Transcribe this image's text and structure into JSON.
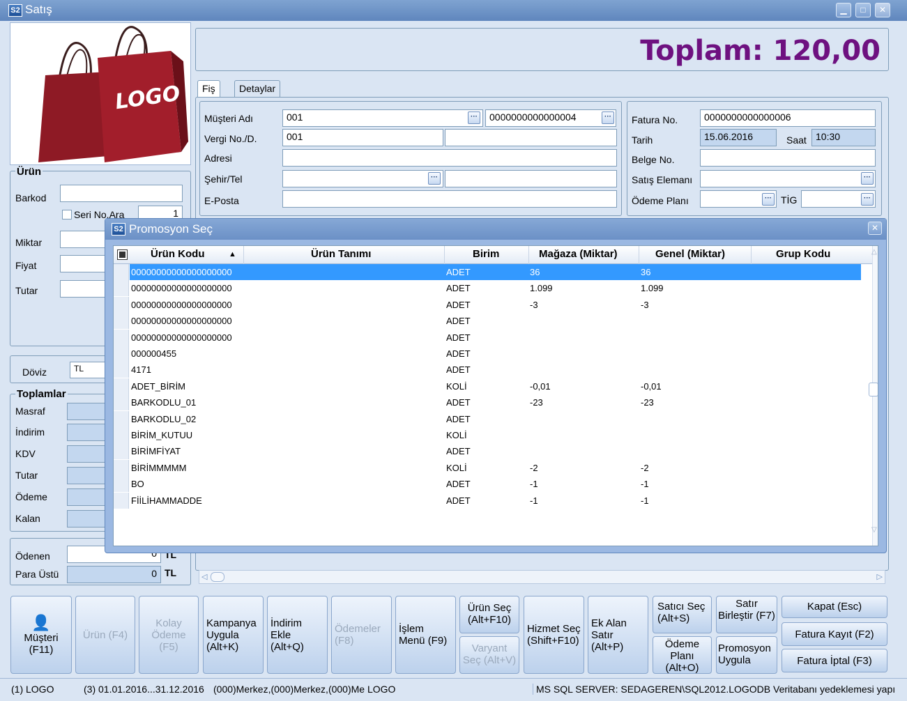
{
  "window": {
    "title": "Satış",
    "icon_text": "S2",
    "buttons": [
      "minimize-icon",
      "maximize-icon",
      "close-icon"
    ]
  },
  "total": {
    "text": "Toplam: 120,00",
    "color": "#6e1180"
  },
  "logo_text": "LOGO",
  "tabs": [
    {
      "label": "Fiş",
      "active": true
    },
    {
      "label": "Detaylar",
      "active": false
    }
  ],
  "musteri": {
    "labels": {
      "adi": "Müşteri Adı",
      "vergi": "Vergi No./D.",
      "adres": "Adresi",
      "sehir": "Şehir/Tel",
      "eposta": "E-Posta"
    },
    "adi_code": "001",
    "adi_name": "0000000000000004",
    "vergi_no": "001"
  },
  "fatura": {
    "labels": {
      "fatura_no": "Fatura No.",
      "tarih": "Tarih",
      "saat": "Saat",
      "belge": "Belge No.",
      "satis_elemani": "Satış Elemanı",
      "odeme_plani": "Ödeme Planı",
      "tig": "TİG"
    },
    "fatura_no": "0000000000000006",
    "tarih": "15.06.2016",
    "saat": "10:30"
  },
  "urun": {
    "title": "Ürün",
    "labels": {
      "barkod": "Barkod",
      "seri": "Seri No.Ara",
      "miktar": "Miktar",
      "fiyat": "Fiyat",
      "tutar": "Tutar"
    },
    "seri_value": "1"
  },
  "doviz": {
    "label": "Döviz",
    "value": "TL"
  },
  "toplamlar": {
    "title": "Toplamlar",
    "labels": [
      "Masraf",
      "İndirim",
      "KDV",
      "Tutar",
      "Ödeme",
      "Kalan"
    ]
  },
  "odenen": {
    "label": "Ödenen",
    "value": "0",
    "unit": "TL"
  },
  "para_ustu": {
    "label": "Para Üstü",
    "value": "0",
    "unit": "TL"
  },
  "buttons": {
    "musteri": "Müşteri (F11)",
    "urun": "Ürün (F4)",
    "kolay": "Kolay Ödeme (F5)",
    "kampanya": "Kampanya Uygula (Alt+K)",
    "indirim": "İndirim Ekle (Alt+Q)",
    "odemeler": "Ödemeler (F8)",
    "islem": "İşlem Menü (F9)",
    "urun_sec": "Ürün Seç (Alt+F10)",
    "varyant": "Varyant Seç (Alt+V)",
    "hizmet": "Hizmet Seç (Shift+F10)",
    "ek_alan": "Ek Alan Satır (Alt+P)",
    "satici": "Satıcı Seç (Alt+S)",
    "odeme_plani": "Ödeme Planı (Alt+O)",
    "satir_birlestir": "Satır Birleştir (F7)",
    "promosyon": "Promosyon Uygula",
    "kapat": "Kapat (Esc)",
    "kayit": "Fatura Kayıt (F2)",
    "iptal": "Fatura İptal (F3)"
  },
  "status": {
    "firm": "(1) LOGO",
    "period": "(3) 01.01.2016...31.12.2016",
    "branch": "(000)Merkez,(000)Merkez,(000)Me LOGO",
    "db": "MS SQL SERVER: SEDAGEREN\\SQL2012.LOGODB Veritabanı yedeklemesi yapı"
  },
  "dialog": {
    "title": "Promosyon Seç",
    "columns": [
      "Ürün Kodu",
      "Ürün Tanımı",
      "Birim",
      "Mağaza (Miktar)",
      "Genel (Miktar)",
      "Grup Kodu"
    ],
    "sort_icon": "sort-up-icon",
    "rows": [
      {
        "kod": "00000000000000000000",
        "tanim": "",
        "birim": "ADET",
        "magaza": "36",
        "genel": "36",
        "grup": "",
        "selected": true
      },
      {
        "kod": "00000000000000000000",
        "tanim": "",
        "birim": "ADET",
        "magaza": "1.099",
        "genel": "1.099",
        "grup": ""
      },
      {
        "kod": "00000000000000000000",
        "tanim": "",
        "birim": "ADET",
        "magaza": "-3",
        "genel": "-3",
        "grup": ""
      },
      {
        "kod": "00000000000000000000",
        "tanim": "",
        "birim": "ADET",
        "magaza": "",
        "genel": "",
        "grup": ""
      },
      {
        "kod": "00000000000000000000",
        "tanim": "",
        "birim": "ADET",
        "magaza": "",
        "genel": "",
        "grup": ""
      },
      {
        "kod": "000000455",
        "tanim": "",
        "birim": "ADET",
        "magaza": "",
        "genel": "",
        "grup": ""
      },
      {
        "kod": "4171",
        "tanim": "",
        "birim": "ADET",
        "magaza": "",
        "genel": "",
        "grup": ""
      },
      {
        "kod": "ADET_BİRİM",
        "tanim": "",
        "birim": "KOLİ",
        "magaza": "-0,01",
        "genel": "-0,01",
        "grup": ""
      },
      {
        "kod": "BARKODLU_01",
        "tanim": "",
        "birim": "ADET",
        "magaza": "-23",
        "genel": "-23",
        "grup": ""
      },
      {
        "kod": "BARKODLU_02",
        "tanim": "",
        "birim": "ADET",
        "magaza": "",
        "genel": "",
        "grup": ""
      },
      {
        "kod": "BİRİM_KUTUU",
        "tanim": "",
        "birim": "KOLİ",
        "magaza": "",
        "genel": "",
        "grup": ""
      },
      {
        "kod": "BİRİMFİYAT",
        "tanim": "",
        "birim": "ADET",
        "magaza": "",
        "genel": "",
        "grup": ""
      },
      {
        "kod": "BİRİMMMMM",
        "tanim": "",
        "birim": "KOLİ",
        "magaza": "-2",
        "genel": "-2",
        "grup": ""
      },
      {
        "kod": "BO",
        "tanim": "",
        "birim": "ADET",
        "magaza": "-1",
        "genel": "-1",
        "grup": ""
      },
      {
        "kod": "FİİLİHAMMADDE",
        "tanim": "",
        "birim": "ADET",
        "magaza": "-1",
        "genel": "-1",
        "grup": ""
      }
    ]
  }
}
